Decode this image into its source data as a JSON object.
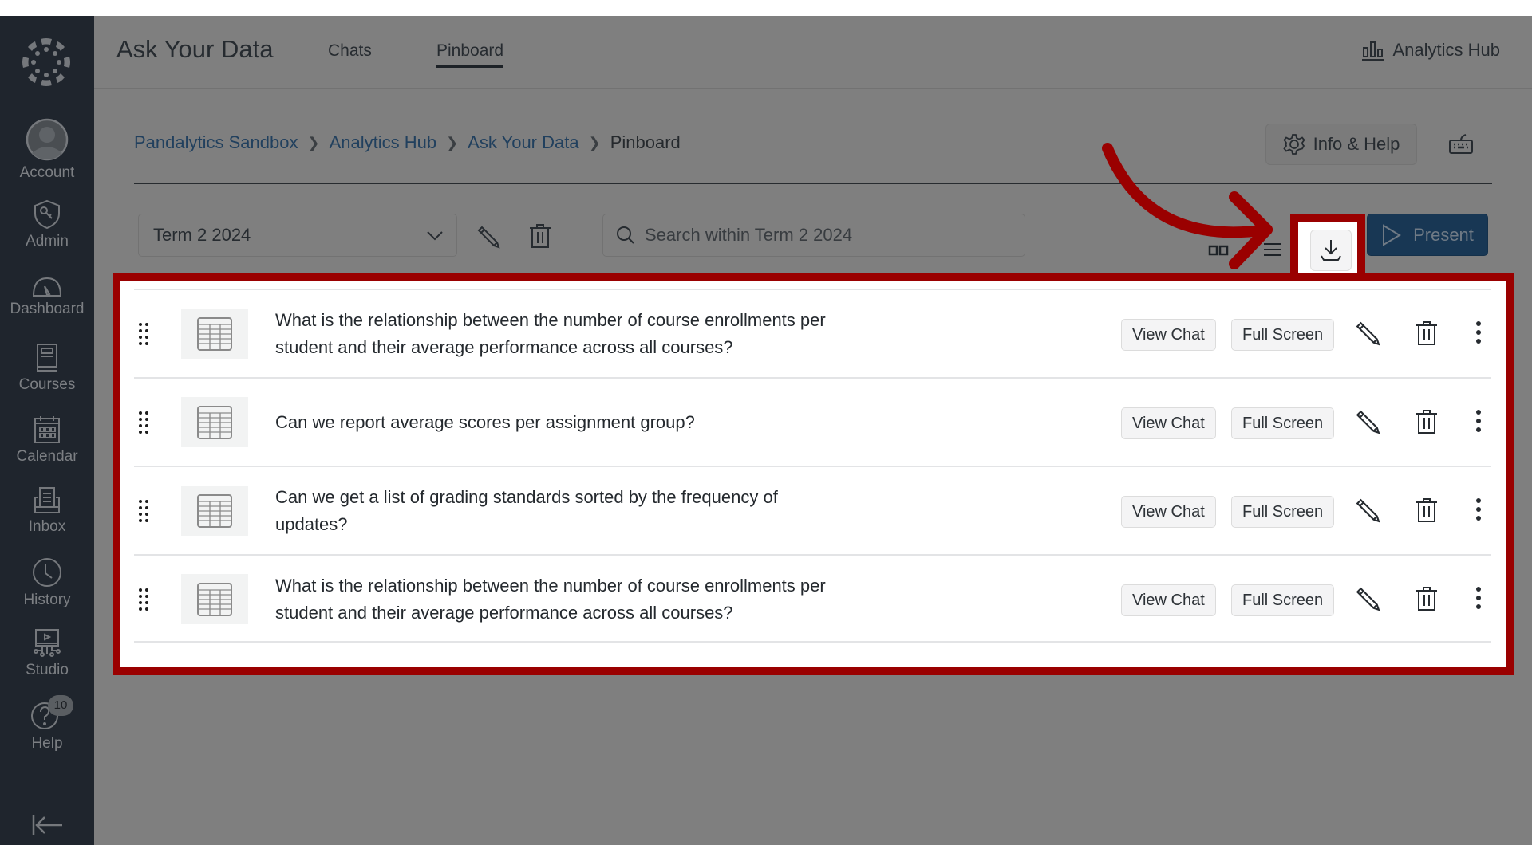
{
  "sidebar": {
    "items": [
      {
        "label": "Account",
        "icon": "account-avatar-icon"
      },
      {
        "label": "Admin",
        "icon": "admin-shield-icon"
      },
      {
        "label": "Dashboard",
        "icon": "dashboard-gauge-icon"
      },
      {
        "label": "Courses",
        "icon": "courses-book-icon"
      },
      {
        "label": "Calendar",
        "icon": "calendar-icon"
      },
      {
        "label": "Inbox",
        "icon": "inbox-icon"
      },
      {
        "label": "History",
        "icon": "history-clock-icon"
      },
      {
        "label": "Studio",
        "icon": "studio-icon"
      },
      {
        "label": "Help",
        "icon": "help-icon",
        "badge": "10"
      }
    ]
  },
  "header": {
    "title": "Ask Your Data",
    "tabs": [
      {
        "label": "Chats",
        "active": false
      },
      {
        "label": "Pinboard",
        "active": true
      }
    ],
    "hub_link": "Analytics Hub"
  },
  "breadcrumb": {
    "items": [
      "Pandalytics Sandbox",
      "Analytics Hub",
      "Ask Your Data"
    ],
    "current": "Pinboard"
  },
  "info_help_label": "Info & Help",
  "toolbar": {
    "term_selected": "Term 2 2024",
    "search_placeholder": "Search within Term 2 2024",
    "present_label": "Present"
  },
  "annotation": {
    "color": "#9a0000",
    "target": "download-button"
  },
  "pins": [
    {
      "question": "What is the relationship between the number of course enrollments per student and their average performance across all courses?",
      "view_chat": "View Chat",
      "full_screen": "Full Screen"
    },
    {
      "question": "Can we report average scores per assignment group?",
      "view_chat": "View Chat",
      "full_screen": "Full Screen"
    },
    {
      "question": "Can we get a list of grading standards sorted by the frequency of updates?",
      "view_chat": "View Chat",
      "full_screen": "Full Screen"
    },
    {
      "question": "What is the relationship between the number of course enrollments per student and their average performance across all courses?",
      "view_chat": "View Chat",
      "full_screen": "Full Screen"
    }
  ]
}
